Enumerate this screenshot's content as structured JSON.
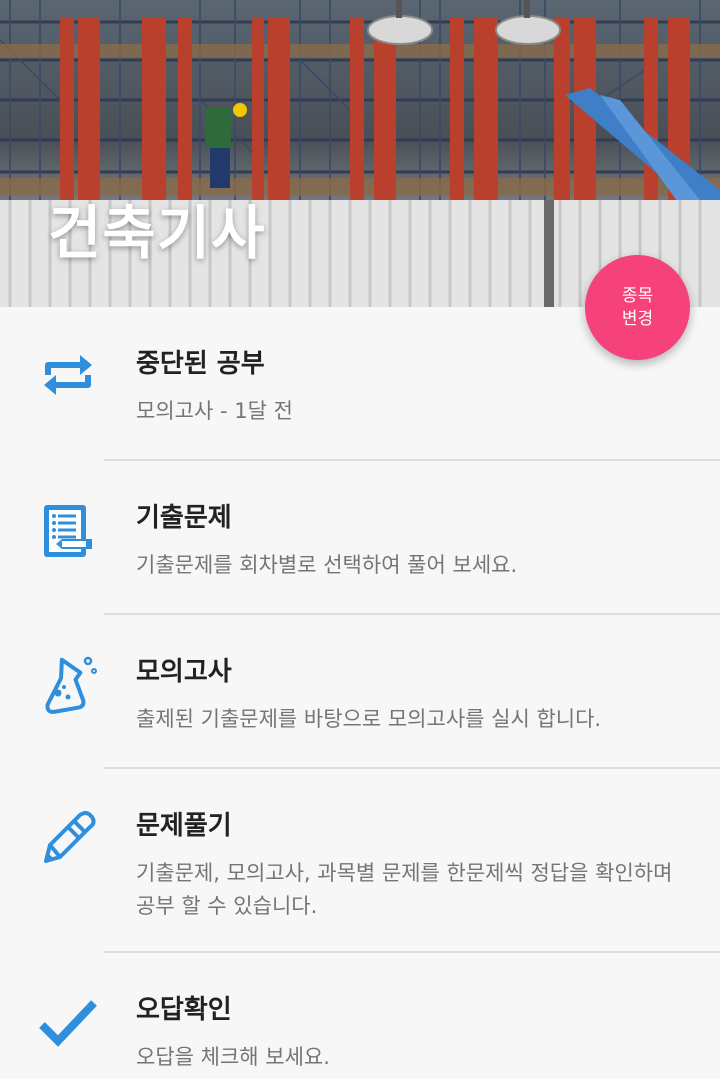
{
  "header": {
    "title": "건축기사"
  },
  "fab": {
    "line1": "종목",
    "line2": "변경"
  },
  "menu": {
    "items": [
      {
        "icon": "swap-arrows-icon",
        "title": "중단된 공부",
        "desc": "모의고사 - 1달 전"
      },
      {
        "icon": "notebook-icon",
        "title": "기출문제",
        "desc": "기출문제를 회차별로 선택하여 풀어 보세요."
      },
      {
        "icon": "flask-icon",
        "title": "모의고사",
        "desc": "출제된 기출문제를 바탕으로 모의고사를 실시 합니다."
      },
      {
        "icon": "pencil-icon",
        "title": "문제풀기",
        "desc": "기출문제, 모의고사, 과목별 문제를 한문제씩 정답을 확인하며 공부 할 수 있습니다."
      },
      {
        "icon": "checkmark-icon",
        "title": "오답확인",
        "desc": "오답을 체크해 보세요."
      }
    ]
  },
  "colors": {
    "accent": "#f5427a",
    "icon": "#2f8fdc"
  }
}
